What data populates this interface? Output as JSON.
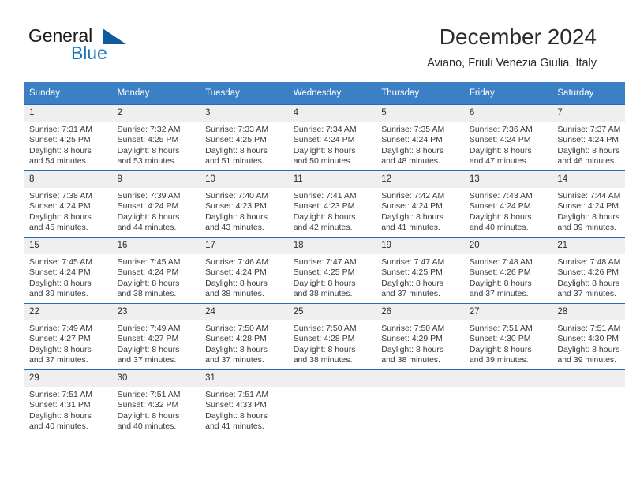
{
  "brand": {
    "word1": "General",
    "word2": "Blue",
    "logo_icon": "triangle-logo-icon",
    "accent_color": "#1a75bb"
  },
  "header": {
    "title": "December 2024",
    "subtitle": "Aviano, Friuli Venezia Giulia, Italy"
  },
  "theme": {
    "header_bg": "#3b7fc4",
    "row_divider": "#2a6ab0",
    "daynum_bg": "#efefef",
    "text": "#3a3a3a"
  },
  "weekday_headers": [
    "Sunday",
    "Monday",
    "Tuesday",
    "Wednesday",
    "Thursday",
    "Friday",
    "Saturday"
  ],
  "weeks": [
    [
      {
        "day": "1",
        "sunrise": "Sunrise: 7:31 AM",
        "sunset": "Sunset: 4:25 PM",
        "daylight1": "Daylight: 8 hours",
        "daylight2": "and 54 minutes."
      },
      {
        "day": "2",
        "sunrise": "Sunrise: 7:32 AM",
        "sunset": "Sunset: 4:25 PM",
        "daylight1": "Daylight: 8 hours",
        "daylight2": "and 53 minutes."
      },
      {
        "day": "3",
        "sunrise": "Sunrise: 7:33 AM",
        "sunset": "Sunset: 4:25 PM",
        "daylight1": "Daylight: 8 hours",
        "daylight2": "and 51 minutes."
      },
      {
        "day": "4",
        "sunrise": "Sunrise: 7:34 AM",
        "sunset": "Sunset: 4:24 PM",
        "daylight1": "Daylight: 8 hours",
        "daylight2": "and 50 minutes."
      },
      {
        "day": "5",
        "sunrise": "Sunrise: 7:35 AM",
        "sunset": "Sunset: 4:24 PM",
        "daylight1": "Daylight: 8 hours",
        "daylight2": "and 48 minutes."
      },
      {
        "day": "6",
        "sunrise": "Sunrise: 7:36 AM",
        "sunset": "Sunset: 4:24 PM",
        "daylight1": "Daylight: 8 hours",
        "daylight2": "and 47 minutes."
      },
      {
        "day": "7",
        "sunrise": "Sunrise: 7:37 AM",
        "sunset": "Sunset: 4:24 PM",
        "daylight1": "Daylight: 8 hours",
        "daylight2": "and 46 minutes."
      }
    ],
    [
      {
        "day": "8",
        "sunrise": "Sunrise: 7:38 AM",
        "sunset": "Sunset: 4:24 PM",
        "daylight1": "Daylight: 8 hours",
        "daylight2": "and 45 minutes."
      },
      {
        "day": "9",
        "sunrise": "Sunrise: 7:39 AM",
        "sunset": "Sunset: 4:24 PM",
        "daylight1": "Daylight: 8 hours",
        "daylight2": "and 44 minutes."
      },
      {
        "day": "10",
        "sunrise": "Sunrise: 7:40 AM",
        "sunset": "Sunset: 4:23 PM",
        "daylight1": "Daylight: 8 hours",
        "daylight2": "and 43 minutes."
      },
      {
        "day": "11",
        "sunrise": "Sunrise: 7:41 AM",
        "sunset": "Sunset: 4:23 PM",
        "daylight1": "Daylight: 8 hours",
        "daylight2": "and 42 minutes."
      },
      {
        "day": "12",
        "sunrise": "Sunrise: 7:42 AM",
        "sunset": "Sunset: 4:24 PM",
        "daylight1": "Daylight: 8 hours",
        "daylight2": "and 41 minutes."
      },
      {
        "day": "13",
        "sunrise": "Sunrise: 7:43 AM",
        "sunset": "Sunset: 4:24 PM",
        "daylight1": "Daylight: 8 hours",
        "daylight2": "and 40 minutes."
      },
      {
        "day": "14",
        "sunrise": "Sunrise: 7:44 AM",
        "sunset": "Sunset: 4:24 PM",
        "daylight1": "Daylight: 8 hours",
        "daylight2": "and 39 minutes."
      }
    ],
    [
      {
        "day": "15",
        "sunrise": "Sunrise: 7:45 AM",
        "sunset": "Sunset: 4:24 PM",
        "daylight1": "Daylight: 8 hours",
        "daylight2": "and 39 minutes."
      },
      {
        "day": "16",
        "sunrise": "Sunrise: 7:45 AM",
        "sunset": "Sunset: 4:24 PM",
        "daylight1": "Daylight: 8 hours",
        "daylight2": "and 38 minutes."
      },
      {
        "day": "17",
        "sunrise": "Sunrise: 7:46 AM",
        "sunset": "Sunset: 4:24 PM",
        "daylight1": "Daylight: 8 hours",
        "daylight2": "and 38 minutes."
      },
      {
        "day": "18",
        "sunrise": "Sunrise: 7:47 AM",
        "sunset": "Sunset: 4:25 PM",
        "daylight1": "Daylight: 8 hours",
        "daylight2": "and 38 minutes."
      },
      {
        "day": "19",
        "sunrise": "Sunrise: 7:47 AM",
        "sunset": "Sunset: 4:25 PM",
        "daylight1": "Daylight: 8 hours",
        "daylight2": "and 37 minutes."
      },
      {
        "day": "20",
        "sunrise": "Sunrise: 7:48 AM",
        "sunset": "Sunset: 4:26 PM",
        "daylight1": "Daylight: 8 hours",
        "daylight2": "and 37 minutes."
      },
      {
        "day": "21",
        "sunrise": "Sunrise: 7:48 AM",
        "sunset": "Sunset: 4:26 PM",
        "daylight1": "Daylight: 8 hours",
        "daylight2": "and 37 minutes."
      }
    ],
    [
      {
        "day": "22",
        "sunrise": "Sunrise: 7:49 AM",
        "sunset": "Sunset: 4:27 PM",
        "daylight1": "Daylight: 8 hours",
        "daylight2": "and 37 minutes."
      },
      {
        "day": "23",
        "sunrise": "Sunrise: 7:49 AM",
        "sunset": "Sunset: 4:27 PM",
        "daylight1": "Daylight: 8 hours",
        "daylight2": "and 37 minutes."
      },
      {
        "day": "24",
        "sunrise": "Sunrise: 7:50 AM",
        "sunset": "Sunset: 4:28 PM",
        "daylight1": "Daylight: 8 hours",
        "daylight2": "and 37 minutes."
      },
      {
        "day": "25",
        "sunrise": "Sunrise: 7:50 AM",
        "sunset": "Sunset: 4:28 PM",
        "daylight1": "Daylight: 8 hours",
        "daylight2": "and 38 minutes."
      },
      {
        "day": "26",
        "sunrise": "Sunrise: 7:50 AM",
        "sunset": "Sunset: 4:29 PM",
        "daylight1": "Daylight: 8 hours",
        "daylight2": "and 38 minutes."
      },
      {
        "day": "27",
        "sunrise": "Sunrise: 7:51 AM",
        "sunset": "Sunset: 4:30 PM",
        "daylight1": "Daylight: 8 hours",
        "daylight2": "and 39 minutes."
      },
      {
        "day": "28",
        "sunrise": "Sunrise: 7:51 AM",
        "sunset": "Sunset: 4:30 PM",
        "daylight1": "Daylight: 8 hours",
        "daylight2": "and 39 minutes."
      }
    ],
    [
      {
        "day": "29",
        "sunrise": "Sunrise: 7:51 AM",
        "sunset": "Sunset: 4:31 PM",
        "daylight1": "Daylight: 8 hours",
        "daylight2": "and 40 minutes."
      },
      {
        "day": "30",
        "sunrise": "Sunrise: 7:51 AM",
        "sunset": "Sunset: 4:32 PM",
        "daylight1": "Daylight: 8 hours",
        "daylight2": "and 40 minutes."
      },
      {
        "day": "31",
        "sunrise": "Sunrise: 7:51 AM",
        "sunset": "Sunset: 4:33 PM",
        "daylight1": "Daylight: 8 hours",
        "daylight2": "and 41 minutes."
      },
      {
        "day": "",
        "sunrise": "",
        "sunset": "",
        "daylight1": "",
        "daylight2": ""
      },
      {
        "day": "",
        "sunrise": "",
        "sunset": "",
        "daylight1": "",
        "daylight2": ""
      },
      {
        "day": "",
        "sunrise": "",
        "sunset": "",
        "daylight1": "",
        "daylight2": ""
      },
      {
        "day": "",
        "sunrise": "",
        "sunset": "",
        "daylight1": "",
        "daylight2": ""
      }
    ]
  ]
}
